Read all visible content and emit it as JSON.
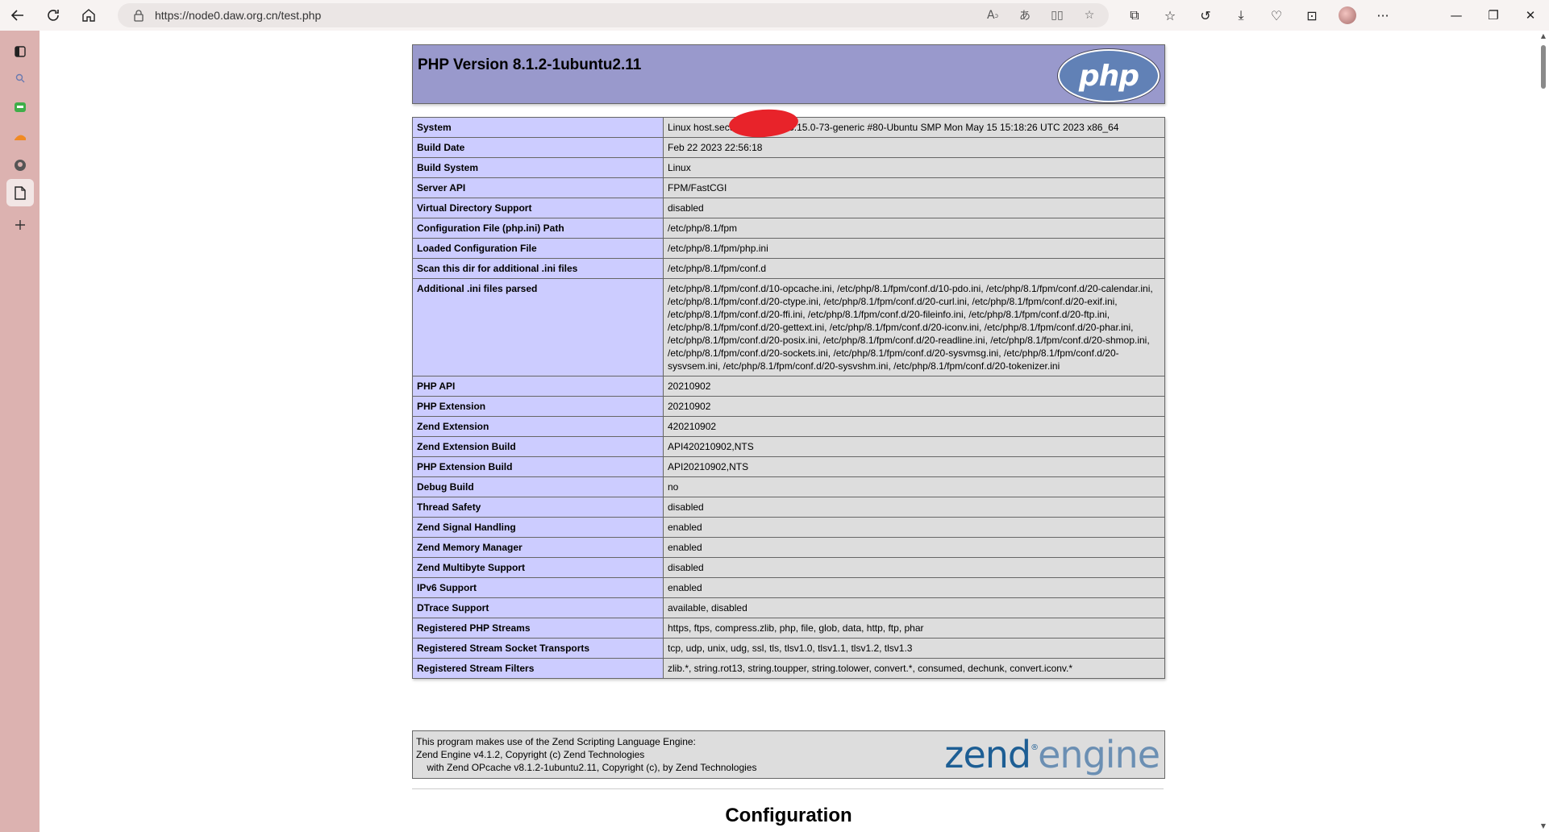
{
  "browser": {
    "url": "https://node0.daw.org.cn/test.php"
  },
  "page": {
    "php_version_title": "PHP Version 8.1.2-1ubuntu2.11",
    "php_logo_text": "php",
    "info_rows": [
      {
        "label": "System",
        "value": "Linux host.secureserver.net 5.15.0-73-generic #80-Ubuntu SMP Mon May 15 15:18:26 UTC 2023 x86_64"
      },
      {
        "label": "Build Date",
        "value": "Feb 22 2023 22:56:18"
      },
      {
        "label": "Build System",
        "value": "Linux"
      },
      {
        "label": "Server API",
        "value": "FPM/FastCGI"
      },
      {
        "label": "Virtual Directory Support",
        "value": "disabled"
      },
      {
        "label": "Configuration File (php.ini) Path",
        "value": "/etc/php/8.1/fpm"
      },
      {
        "label": "Loaded Configuration File",
        "value": "/etc/php/8.1/fpm/php.ini"
      },
      {
        "label": "Scan this dir for additional .ini files",
        "value": "/etc/php/8.1/fpm/conf.d"
      },
      {
        "label": "Additional .ini files parsed",
        "value": "/etc/php/8.1/fpm/conf.d/10-opcache.ini, /etc/php/8.1/fpm/conf.d/10-pdo.ini, /etc/php/8.1/fpm/conf.d/20-calendar.ini, /etc/php/8.1/fpm/conf.d/20-ctype.ini, /etc/php/8.1/fpm/conf.d/20-curl.ini, /etc/php/8.1/fpm/conf.d/20-exif.ini, /etc/php/8.1/fpm/conf.d/20-ffi.ini, /etc/php/8.1/fpm/conf.d/20-fileinfo.ini, /etc/php/8.1/fpm/conf.d/20-ftp.ini, /etc/php/8.1/fpm/conf.d/20-gettext.ini, /etc/php/8.1/fpm/conf.d/20-iconv.ini, /etc/php/8.1/fpm/conf.d/20-phar.ini, /etc/php/8.1/fpm/conf.d/20-posix.ini, /etc/php/8.1/fpm/conf.d/20-readline.ini, /etc/php/8.1/fpm/conf.d/20-shmop.ini, /etc/php/8.1/fpm/conf.d/20-sockets.ini, /etc/php/8.1/fpm/conf.d/20-sysvmsg.ini, /etc/php/8.1/fpm/conf.d/20-sysvsem.ini, /etc/php/8.1/fpm/conf.d/20-sysvshm.ini, /etc/php/8.1/fpm/conf.d/20-tokenizer.ini"
      },
      {
        "label": "PHP API",
        "value": "20210902"
      },
      {
        "label": "PHP Extension",
        "value": "20210902"
      },
      {
        "label": "Zend Extension",
        "value": "420210902"
      },
      {
        "label": "Zend Extension Build",
        "value": "API420210902,NTS"
      },
      {
        "label": "PHP Extension Build",
        "value": "API20210902,NTS"
      },
      {
        "label": "Debug Build",
        "value": "no"
      },
      {
        "label": "Thread Safety",
        "value": "disabled"
      },
      {
        "label": "Zend Signal Handling",
        "value": "enabled"
      },
      {
        "label": "Zend Memory Manager",
        "value": "enabled"
      },
      {
        "label": "Zend Multibyte Support",
        "value": "disabled"
      },
      {
        "label": "IPv6 Support",
        "value": "enabled"
      },
      {
        "label": "DTrace Support",
        "value": "available, disabled"
      },
      {
        "label": "Registered PHP Streams",
        "value": "https, ftps, compress.zlib, php, file, glob, data, http, ftp, phar"
      },
      {
        "label": "Registered Stream Socket Transports",
        "value": "tcp, udp, unix, udg, ssl, tls, tlsv1.0, tlsv1.1, tlsv1.2, tlsv1.3"
      },
      {
        "label": "Registered Stream Filters",
        "value": "zlib.*, string.rot13, string.toupper, string.tolower, convert.*, consumed, dechunk, convert.iconv.*"
      }
    ],
    "zend": {
      "line1": "This program makes use of the Zend Scripting Language Engine:",
      "line2": "Zend Engine v4.1.2, Copyright (c) Zend Technologies",
      "line3": "    with Zend OPcache v8.1.2-1ubuntu2.11, Copyright (c), by Zend Technologies",
      "logo_main": "zend",
      "logo_reg": "®",
      "logo_engine": "engine"
    },
    "configuration_heading": "Configuration"
  },
  "colors": {
    "header_bg": "#9999cc",
    "label_bg": "#ccccff",
    "value_bg": "#dddddd",
    "sidebar_bg": "#dcb2b0",
    "redaction": "#e8232a"
  },
  "icons": {
    "sidebar": [
      "tab-actions-icon",
      "search-icon",
      "app-icon-green",
      "app-icon-orange",
      "github-icon",
      "document-icon",
      "add-icon"
    ]
  }
}
